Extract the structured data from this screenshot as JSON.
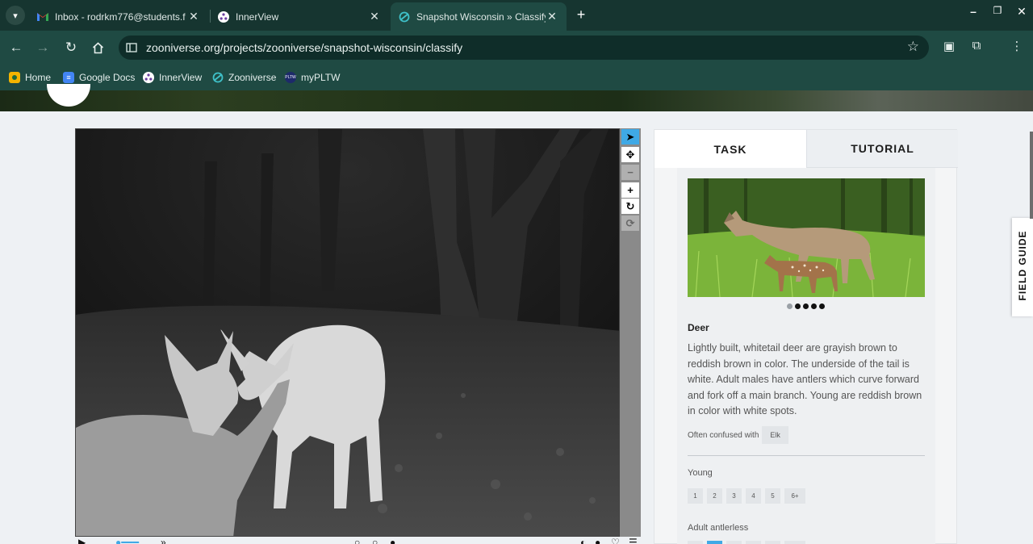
{
  "browser": {
    "tabs": [
      {
        "title": "Inbox - rodrkm776@students.f",
        "icon": "gmail-icon"
      },
      {
        "title": "InnerView",
        "icon": "innerview-icon"
      },
      {
        "title": "Snapshot Wisconsin » Classify",
        "icon": "zooniverse-icon",
        "active": true
      }
    ],
    "url": "zooniverse.org/projects/zooniverse/snapshot-wisconsin/classify",
    "bookmarks": [
      {
        "label": "Home",
        "icon": "classroom-icon"
      },
      {
        "label": "Google Docs",
        "icon": "docs-icon"
      },
      {
        "label": "InnerView",
        "icon": "innerview-icon"
      },
      {
        "label": "Zooniverse",
        "icon": "zooniverse-icon"
      },
      {
        "label": "myPLTW",
        "icon": "pltw-icon"
      }
    ],
    "theme_color": "#1f4a43"
  },
  "image_tools": [
    "pointer-icon",
    "move-icon",
    "zoom-out-icon",
    "zoom-in-icon",
    "rotate-icon",
    "reset-icon"
  ],
  "panel": {
    "tab_task": "TASK",
    "tab_tutorial": "TUTORIAL",
    "animal_name": "Deer",
    "animal_description": "Lightly built, whitetail deer are grayish brown to reddish brown in color. The underside of the tail is white. Adult males have antlers which curve forward and fork off a main branch. Young are reddish brown in color with white spots.",
    "confused_label": "Often confused with",
    "confused_with": "Elk",
    "carousel_dots": 5,
    "carousel_active": 0,
    "young_label": "Young",
    "young_options": [
      "1",
      "2",
      "3",
      "4",
      "5",
      "6+"
    ],
    "antlerless_label": "Adult antlerless",
    "accent": "#3fa9e6"
  },
  "field_guide": "FIELD GUIDE"
}
